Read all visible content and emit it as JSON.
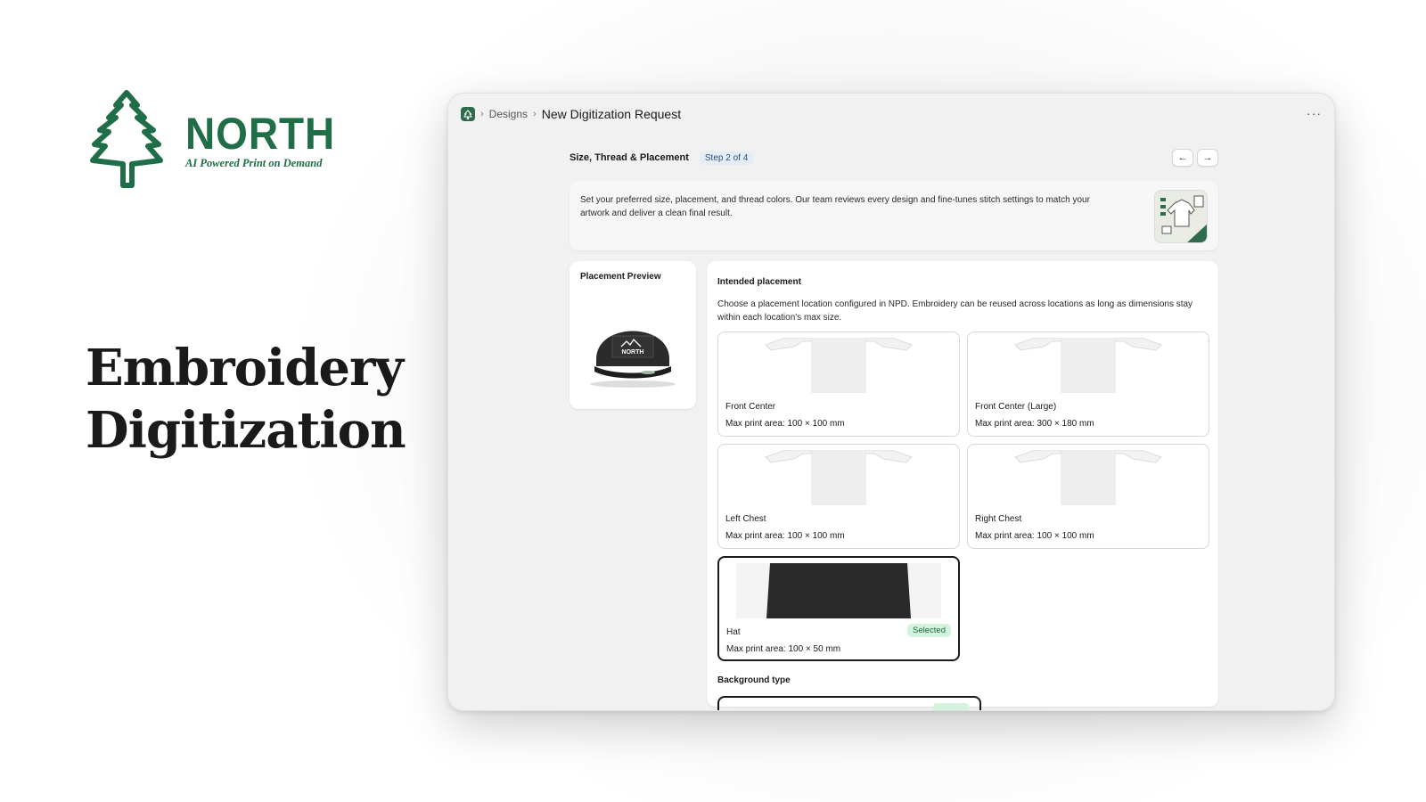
{
  "brand": {
    "name": "NORTH",
    "tagline": "AI Powered Print on Demand",
    "color": "#1f6e47",
    "logo_icon": "pine-tree-icon"
  },
  "headline": {
    "line1": "Embroidery",
    "line2": "Digitization"
  },
  "app": {
    "breadcrumb": {
      "home_icon": "home-tree-icon",
      "separator": "›",
      "parent": "Designs",
      "current": "New Digitization Request"
    },
    "more_menu": "···",
    "step": {
      "section": "Size, Thread & Placement",
      "badge": "Step 2 of 4",
      "prev_icon": "←",
      "next_icon": "→"
    },
    "intro": {
      "text": "Set your preferred size, placement, and thread colors. Our team reviews every design and fine-tunes stitch settings to match your artwork and deliver a clean final result."
    },
    "preview": {
      "title": "Placement Preview",
      "hat_logo": "NORTH"
    },
    "placement": {
      "title": "Intended placement",
      "help": "Choose a placement location configured in NPD. Embroidery can be reused across locations as long as dimensions stay within each location's max size.",
      "locations": [
        {
          "name": "Front Center",
          "size": "Max print area: 100 × 100 mm",
          "thumb": "tshirt",
          "selected": false
        },
        {
          "name": "Front Center (Large)",
          "size": "Max print area: 300 × 180 mm",
          "thumb": "tshirt",
          "selected": false
        },
        {
          "name": "Left Chest",
          "size": "Max print area: 100 × 100 mm",
          "thumb": "tshirt",
          "selected": false
        },
        {
          "name": "Right Chest",
          "size": "Max print area: 100 × 100 mm",
          "thumb": "tshirt",
          "selected": false
        },
        {
          "name": "Hat",
          "size": "Max print area: 100 × 50 mm",
          "thumb": "hat",
          "selected": true,
          "badge": "Selected"
        }
      ]
    },
    "background": {
      "title": "Background type"
    }
  }
}
